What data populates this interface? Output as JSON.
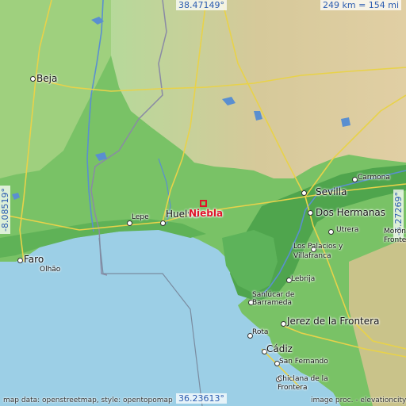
{
  "map": {
    "place": "Niebla",
    "coords": {
      "north": "38.47149°",
      "south": "36.23613°",
      "west": "-8.08519°",
      "east": "-5.27269°"
    },
    "scale": "249 km = 154 mi",
    "attribution_left": "map data: openstreetmap, style: opentopomap",
    "attribution_right": "image proc. - elevationcity",
    "towns": {
      "beja": "Beja",
      "faro": "Faro",
      "olhao": "Olhão",
      "lepe": "Lepe",
      "huelva": "Huelva",
      "sevilla": "Sevilla",
      "carmona": "Carmona",
      "dos_hermanas": "Dos Hermanas",
      "utrera": "Utrera",
      "moron_1": "Morón",
      "moron_2": "Fronte",
      "los_palacios_1": "Los Palacios y",
      "los_palacios_2": "Villafranca",
      "lebrija": "Lebrija",
      "sanlucar_1": "Sanlúcar de",
      "sanlucar_2": "Barrameda",
      "jerez": "Jerez de la Frontera",
      "rota": "Rota",
      "cadiz": "Cádiz",
      "san_fernando": "San Fernando",
      "chiclana_1": "Chiclana de la",
      "chiclana_2": "Frontera"
    },
    "colors": {
      "sea": "#9ccfe6",
      "lowland": "#6fbf59",
      "midland": "#a9d08a",
      "upland": "#d8c79a",
      "road": "#e8d24a",
      "marker": "#e0142a"
    }
  }
}
